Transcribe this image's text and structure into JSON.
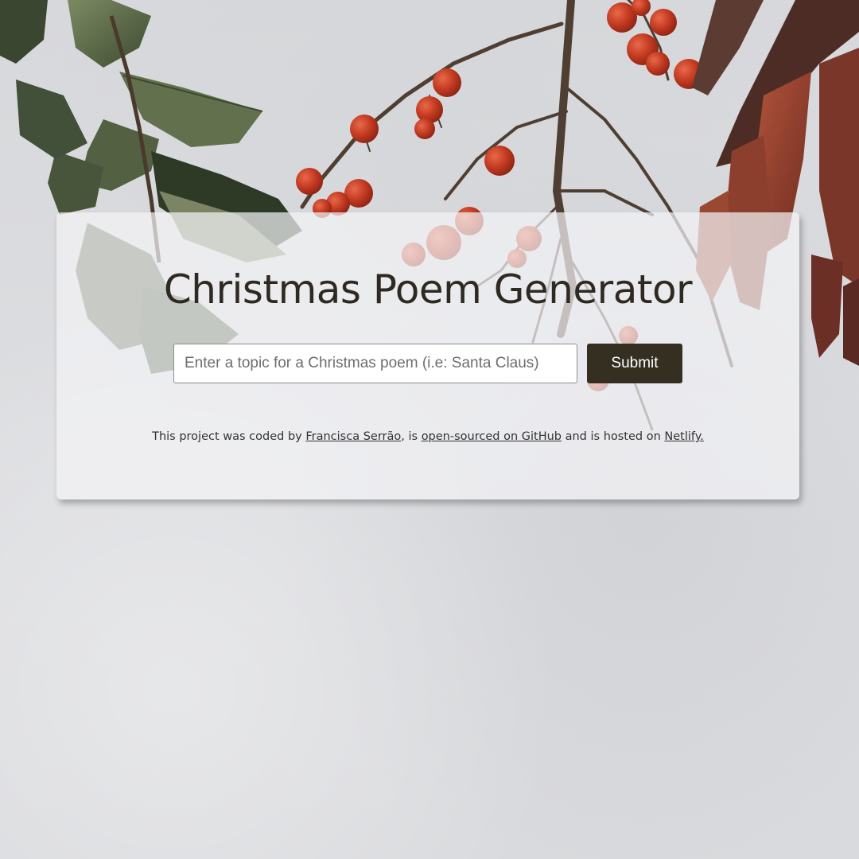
{
  "app": {
    "title": "Christmas Poem Generator"
  },
  "form": {
    "placeholder": "Enter a topic for a Christmas poem (i.e: Santa Claus)",
    "value": "",
    "submit_label": "Submit"
  },
  "footer": {
    "text_1": "This project was coded by ",
    "author_link": "Francisca Serrão",
    "text_2": ", is ",
    "github_link": "open-sourced on GitHub",
    "text_3": " and is hosted on ",
    "netlify_link": "Netlify."
  },
  "colors": {
    "accent": "#352f22",
    "title": "#2f2a21",
    "berry": "#c23a22",
    "leaf": "#5d6a48",
    "background": "#d9dadd"
  },
  "icons": {
    "background": "holly-berries-branch-photo"
  }
}
